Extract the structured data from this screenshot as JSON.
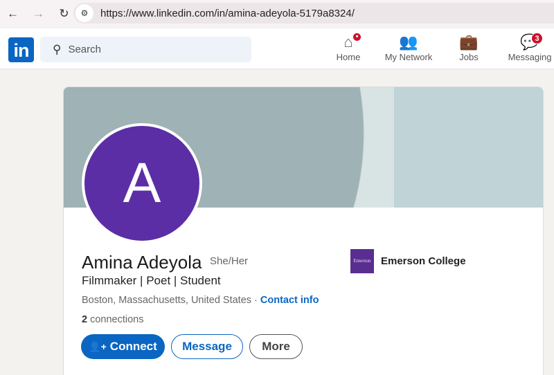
{
  "browser": {
    "url": "https://www.linkedin.com/in/amina-adeyola-5179a8324/"
  },
  "header": {
    "logo": "in",
    "search_placeholder": "Search",
    "nav": [
      {
        "label": "Home",
        "badge": ""
      },
      {
        "label": "My Network"
      },
      {
        "label": "Jobs"
      },
      {
        "label": "Messaging",
        "badge": "3"
      }
    ]
  },
  "profile": {
    "avatar_letter": "A",
    "name": "Amina Adeyola",
    "pronouns": "She/Her",
    "headline": "Filmmaker | Poet | Student",
    "location": "Boston, Massachusetts, United States",
    "separator": " · ",
    "contact_info": "Contact info",
    "connections_count": "2",
    "connections_label": " connections",
    "education": {
      "school": "Emerson College",
      "logo_text": "Emerson"
    },
    "buttons": {
      "connect": "Connect",
      "message": "Message",
      "more": "More"
    }
  },
  "colors": {
    "brand": "#0a66c2",
    "avatar": "#5b2ea6",
    "badge": "#cb112d"
  }
}
